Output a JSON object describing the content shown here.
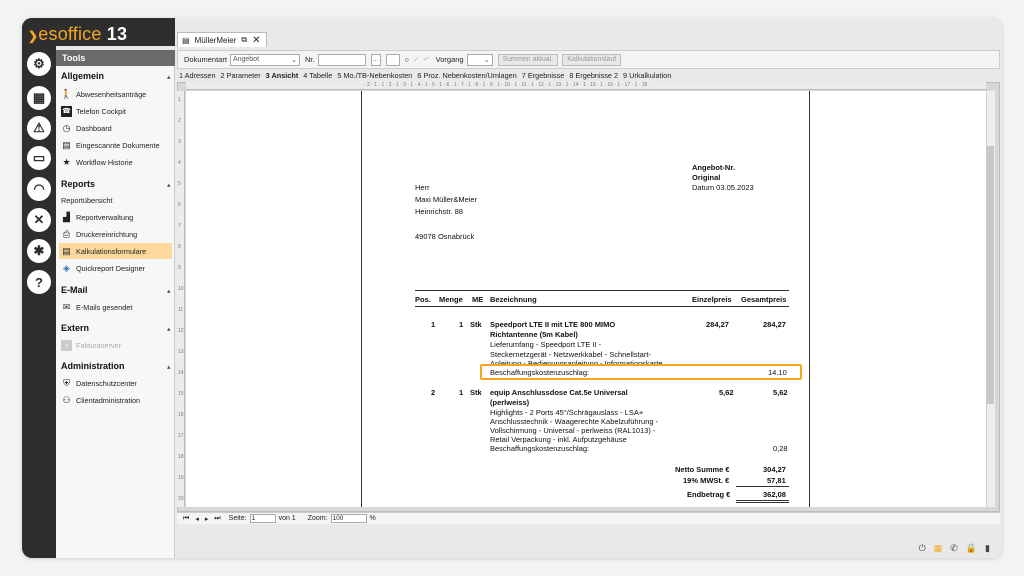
{
  "app": {
    "brand_prefix": "es",
    "brand_main": "office",
    "brand_version": "13"
  },
  "rail": [
    {
      "icon": "gear-icon",
      "glyph": "⚙"
    },
    {
      "icon": "calendar-icon",
      "glyph": "▦"
    },
    {
      "icon": "alarm-icon",
      "glyph": "⚠"
    },
    {
      "icon": "cash-icon",
      "glyph": "▭"
    },
    {
      "icon": "headset-icon",
      "glyph": "◠"
    },
    {
      "icon": "tools-icon",
      "glyph": "✕"
    },
    {
      "icon": "cogs-icon",
      "glyph": "✱"
    },
    {
      "icon": "help-icon",
      "glyph": "?"
    }
  ],
  "sidebar": {
    "header": "Tools",
    "allgemein": "Allgemein",
    "allgemein_items": [
      "Abwesenheitsanträge",
      "Telefon Cockpit",
      "Dashboard",
      "Eingescannte Dokumente",
      "Workflow Historie"
    ],
    "reports": "Reports",
    "reports_items": [
      "Reportübersicht",
      "Reportverwaltung",
      "Druckereinrichtung",
      "Kalkulationsformulare",
      "Quickreport Designer"
    ],
    "email": "E-Mail",
    "email_items": [
      "E-Mails gesendet"
    ],
    "extern": "Extern",
    "extern_items": [
      "Fakturaserver"
    ],
    "administration": "Administration",
    "administration_items": [
      "Datenschutzcenter",
      "Clientadministration"
    ]
  },
  "doctab": {
    "label": "MüllerMeier"
  },
  "toolbar": {
    "dokumentart_label": "Dokumentart",
    "dokumentart_value": "Angebot",
    "nr_label": "Nr.",
    "nr_value": "",
    "vorgang_label": "Vorgang",
    "summen_label": "Summen aktual.",
    "kalkulation_label": "Kalkulationslauf"
  },
  "tabs": [
    "1 Adressen",
    "2 Parameter",
    "3 Ansicht",
    "4 Tabelle",
    "5 Mo./TB-Nebenkosten",
    "6 Proz. Nebenkosten/Umlagen",
    "7 Ergebnisse",
    "8 Ergebnisse 2",
    "9 Urkalkulation"
  ],
  "ruler_top": "· 2 · 1 · 1 · 2 · 1 · 3 · 1 · 4 · 1 · 5 · 1 · 6 · 1 · 7 · 1 · 8 · 1 · 9 · 1 · 10 · 1 · 11 · 1 · 12 · 1 · 13 · 1 · 14 · 1 · 15 · 1 · 16 · 1 · 17 · 1 · 18 ·",
  "ruler_left": [
    "1",
    "2",
    "3",
    "4",
    "5",
    "6",
    "7",
    "8",
    "9",
    "10",
    "11",
    "12",
    "13",
    "14",
    "15",
    "16",
    "17",
    "18",
    "19",
    "20"
  ],
  "document": {
    "angebot_nr": "Angebot-Nr.",
    "original": "Original",
    "datum": "Datum 03.05.2023",
    "salutation": "Herr",
    "name": "Maxi Müller&Meier",
    "street": "Heinrichstr. 88",
    "city": "49078 Osnabrück",
    "col_pos": "Pos.",
    "col_menge": "Menge",
    "col_me": "ME",
    "col_bez": "Bezeichnung",
    "col_ep": "Einzelpreis",
    "col_gp": "Gesamtpreis",
    "pos1": {
      "pos": "1",
      "menge": "1",
      "me": "Stk",
      "title1": "Speedport LTE II mit LTE 800 MIMO",
      "title2": "Richtantenne (5m Kabel)",
      "desc1": "Lieferumfang - Speedport LTE II -",
      "desc2": "Steckernetzgerät - Netzwerkkabel - Schnellstart-",
      "desc3": "Anleitung - Bedienungsanleitung - Informationskarte",
      "surcharge_label": "Beschaffungskostenzuschlag:",
      "surcharge_value": "14.10",
      "ep": "284,27",
      "gp": "284,27"
    },
    "pos2": {
      "pos": "2",
      "menge": "1",
      "me": "Stk",
      "title1": "equip Anschlussdose Cat.5e Universal",
      "title2": "(perlweiss)",
      "desc1": "Highlights - 2 Ports 45°/Schrägauslass - LSA+",
      "desc2": "Anschlusstechnik - Waagerechte Kabelzuführung -",
      "desc3": "Vollschirmung - Universal - perlweiss (RAL1013) -",
      "desc4": "Retail Verpackung - inkl. Aufputzgehäuse",
      "surcharge_label": "Beschaffungskostenzuschlag:",
      "surcharge_value": "0,28",
      "ep": "5,62",
      "gp": "5,62"
    },
    "netto_label": "Netto Summe €",
    "netto_value": "304,27",
    "mwst_label": "19% MWSt. €",
    "mwst_value": "57,81",
    "end_label": "Endbetrag €",
    "end_value": "362,08"
  },
  "statusbar": {
    "seite_label": "Seite:",
    "seite_value": "1",
    "von_label": "von 1",
    "zoom_label": "Zoom:",
    "zoom_value": "100",
    "percent": "%"
  },
  "colors": {
    "accent": "#f5a623",
    "rail": "#2e2e2e"
  }
}
